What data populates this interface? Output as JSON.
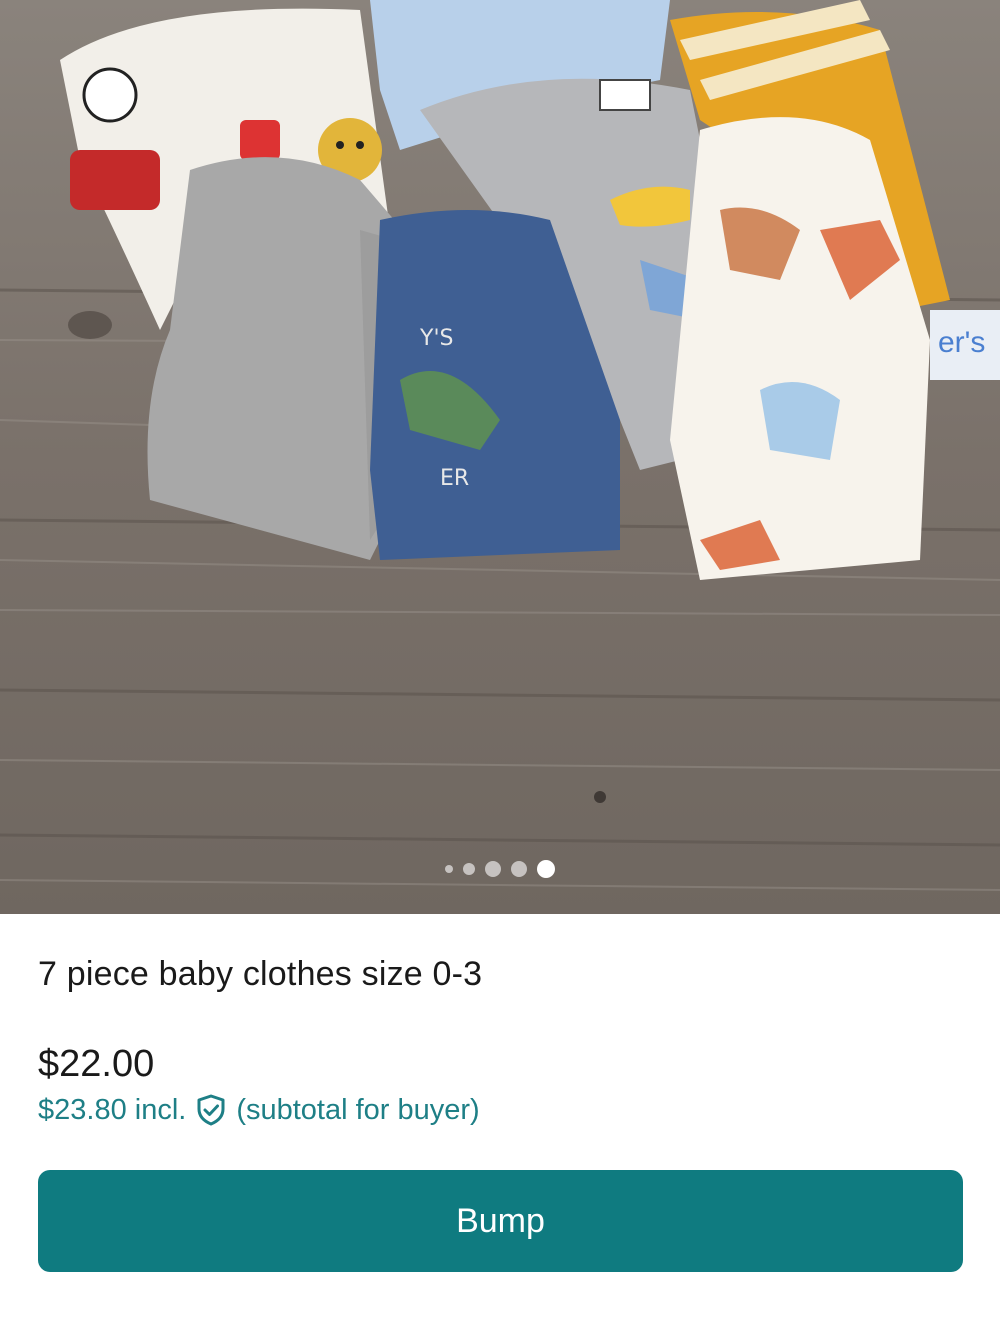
{
  "gallery": {
    "photo_alt": "",
    "dot_count": 5,
    "active_dot_index": 4,
    "tag_text": "er's"
  },
  "listing": {
    "title": "7 piece baby clothes size 0-3",
    "price": "$22.00",
    "buyer_price": "$23.80 incl.",
    "buyer_note": "(subtotal for buyer)"
  },
  "actions": {
    "bump_label": "Bump"
  },
  "colors": {
    "accent": "#0f7b80",
    "accent_text": "#1e7f86",
    "text": "#1a1a1a"
  },
  "icons": {
    "buyer_protection": "shield-check-icon"
  }
}
